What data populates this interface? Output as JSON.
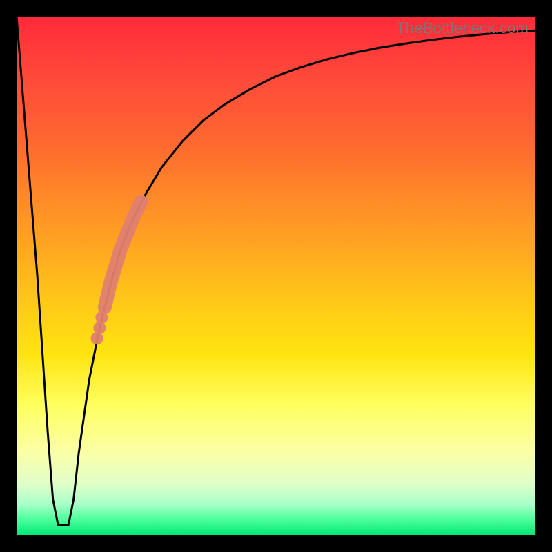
{
  "watermark": "TheBottleneck.com",
  "chart_data": {
    "type": "line",
    "title": "",
    "xlabel": "",
    "ylabel": "",
    "xlim": [
      0,
      100
    ],
    "ylim": [
      0,
      100
    ],
    "series": [
      {
        "name": "bottleneck-curve",
        "x": [
          0,
          2,
          4,
          5,
          6,
          7,
          8,
          9,
          10,
          11,
          12,
          14,
          16,
          18,
          20,
          22,
          25,
          28,
          32,
          36,
          40,
          45,
          50,
          55,
          60,
          65,
          70,
          75,
          80,
          85,
          90,
          95,
          100
        ],
        "values": [
          100,
          75,
          50,
          35,
          20,
          7,
          2,
          2,
          2,
          7,
          16,
          30,
          40,
          48,
          55,
          60,
          66,
          71,
          76,
          80,
          83,
          86,
          88.5,
          90.3,
          91.8,
          93,
          94,
          94.8,
          95.5,
          96.1,
          96.6,
          97,
          97.3
        ]
      }
    ],
    "highlight": {
      "name": "sweet-spot-band",
      "color": "#e08070",
      "points": [
        {
          "x": 17,
          "y": 44
        },
        {
          "x": 17.6,
          "y": 46.5
        },
        {
          "x": 18.2,
          "y": 49
        },
        {
          "x": 18.8,
          "y": 51
        },
        {
          "x": 19.4,
          "y": 53
        },
        {
          "x": 20,
          "y": 55
        },
        {
          "x": 20.8,
          "y": 57
        },
        {
          "x": 21.6,
          "y": 59
        },
        {
          "x": 22.4,
          "y": 61
        },
        {
          "x": 23.2,
          "y": 62.7
        },
        {
          "x": 24,
          "y": 64.3
        }
      ],
      "extra_dots": [
        {
          "x": 15.5,
          "y": 38
        },
        {
          "x": 16,
          "y": 40
        },
        {
          "x": 16.4,
          "y": 42
        }
      ]
    },
    "gradient": {
      "top_color": "#ff2a3a",
      "mid_color": "#ffff60",
      "bottom_color": "#00e676"
    }
  }
}
